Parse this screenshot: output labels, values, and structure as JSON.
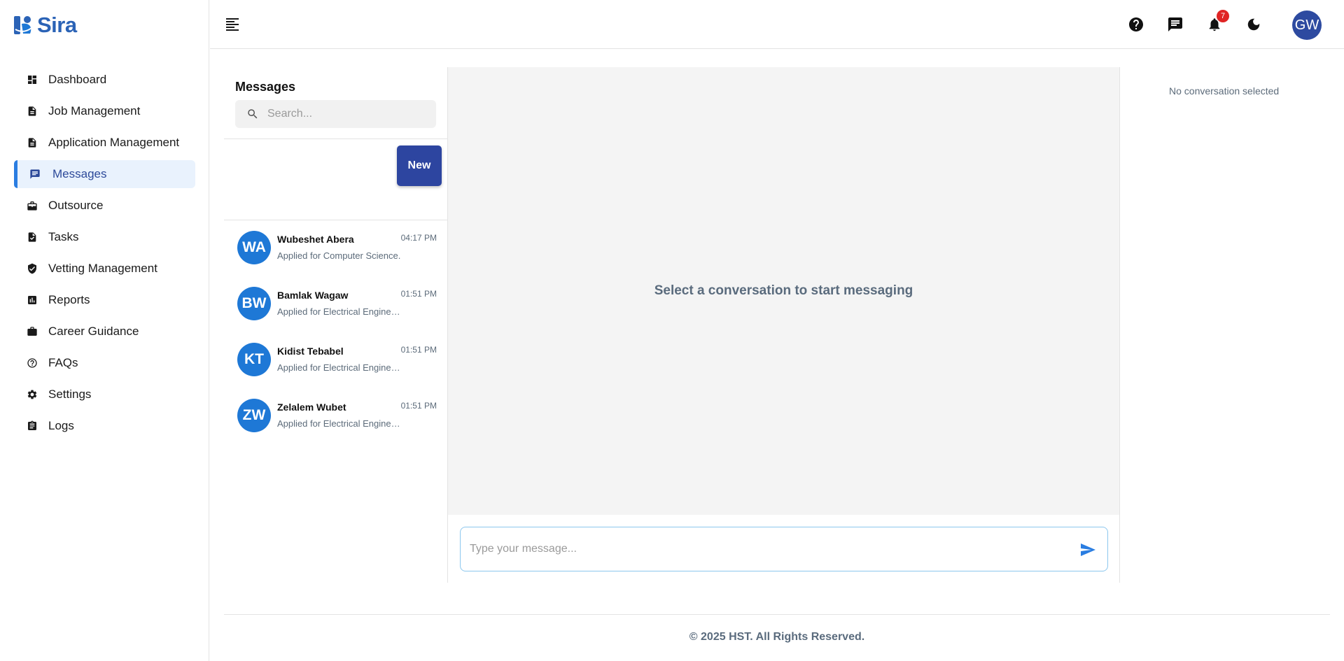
{
  "app": {
    "name": "Sira",
    "brand_color": "#2b63b6",
    "accent_color": "#2a7de1"
  },
  "sidebar": {
    "items": [
      {
        "label": "Dashboard",
        "icon": "dashboard-icon",
        "active": false
      },
      {
        "label": "Job Management",
        "icon": "document-icon",
        "active": false
      },
      {
        "label": "Application Management",
        "icon": "document-icon",
        "active": false
      },
      {
        "label": "Messages",
        "icon": "message-icon",
        "active": true
      },
      {
        "label": "Outsource",
        "icon": "briefcase-outline-icon",
        "active": false
      },
      {
        "label": "Tasks",
        "icon": "task-icon",
        "active": false
      },
      {
        "label": "Vetting Management",
        "icon": "shield-check-icon",
        "active": false
      },
      {
        "label": "Reports",
        "icon": "bar-chart-icon",
        "active": false
      },
      {
        "label": "Career Guidance",
        "icon": "briefcase-icon",
        "active": false
      },
      {
        "label": "FAQs",
        "icon": "help-outline-icon",
        "active": false
      },
      {
        "label": "Settings",
        "icon": "gear-icon",
        "active": false
      },
      {
        "label": "Logs",
        "icon": "clipboard-icon",
        "active": false
      }
    ]
  },
  "topbar": {
    "notifications_count": "7",
    "user_initials": "GW"
  },
  "conversations": {
    "title": "Messages",
    "search_placeholder": "Search...",
    "new_label": "New",
    "items": [
      {
        "initials": "WA",
        "name": "Wubeshet Abera",
        "time": "04:17 PM",
        "preview": "Applied for Computer Science."
      },
      {
        "initials": "BW",
        "name": "Bamlak Wagaw",
        "time": "01:51 PM",
        "preview": "Applied for Electrical Engineering"
      },
      {
        "initials": "KT",
        "name": "Kidist Tebabel",
        "time": "01:51 PM",
        "preview": "Applied for Electrical Engineering"
      },
      {
        "initials": "ZW",
        "name": "Zelalem Wubet",
        "time": "01:51 PM",
        "preview": "Applied for Electrical Engineering"
      }
    ]
  },
  "chat": {
    "empty_text": "Select a conversation to start messaging",
    "compose_placeholder": "Type your message..."
  },
  "details": {
    "empty_text": "No conversation selected"
  },
  "footer": {
    "text": "© 2025 HST. All Rights Reserved."
  }
}
